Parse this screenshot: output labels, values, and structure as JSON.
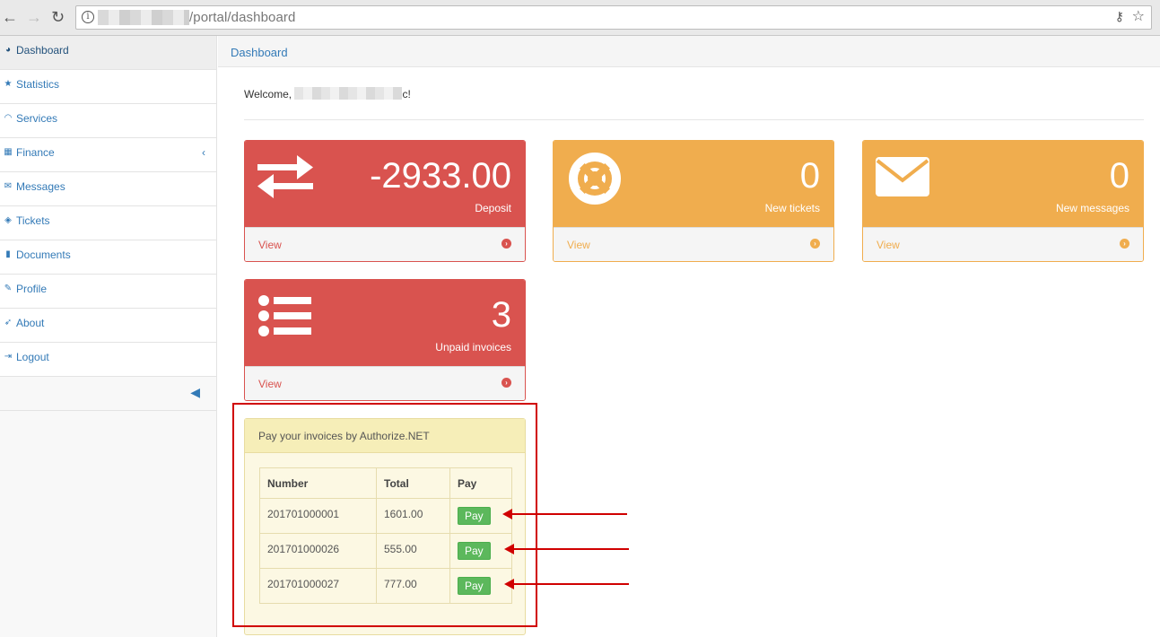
{
  "browser": {
    "url": "/portal/dashboard"
  },
  "sidebar": {
    "items": [
      {
        "label": "Dashboard",
        "icon": "dashboard-icon"
      },
      {
        "label": "Statistics",
        "icon": "star-icon"
      },
      {
        "label": "Services",
        "icon": "wifi-icon"
      },
      {
        "label": "Finance",
        "icon": "calculator-icon"
      },
      {
        "label": "Messages",
        "icon": "envelope-icon"
      },
      {
        "label": "Tickets",
        "icon": "ticket-icon"
      },
      {
        "label": "Documents",
        "icon": "document-icon"
      },
      {
        "label": "Profile",
        "icon": "pencil-icon"
      },
      {
        "label": "About",
        "icon": "rocket-icon"
      },
      {
        "label": "Logout",
        "icon": "sign-out-icon"
      }
    ]
  },
  "breadcrumb": {
    "current": "Dashboard"
  },
  "welcome": {
    "prefix": "Welcome,",
    "suffix": "c!"
  },
  "cards": {
    "deposit": {
      "value": "-2933.00",
      "label": "Deposit",
      "link": "View"
    },
    "tickets": {
      "value": "0",
      "label": "New tickets",
      "link": "View"
    },
    "messages": {
      "value": "0",
      "label": "New messages",
      "link": "View"
    },
    "invoices": {
      "value": "3",
      "label": "Unpaid invoices",
      "link": "View"
    }
  },
  "pay_panel": {
    "title": "Pay your invoices by Authorize.NET",
    "columns": [
      "Number",
      "Total",
      "Pay"
    ],
    "rows": [
      {
        "number": "201701000001",
        "total": "1601.00",
        "action": "Pay"
      },
      {
        "number": "201701000026",
        "total": "555.00",
        "action": "Pay"
      },
      {
        "number": "201701000027",
        "total": "777.00",
        "action": "Pay"
      }
    ]
  },
  "colors": {
    "danger": "#d9534f",
    "warning": "#f0ad4e",
    "success": "#5cb85c",
    "link": "#337ab7",
    "annotation": "#d00000"
  }
}
